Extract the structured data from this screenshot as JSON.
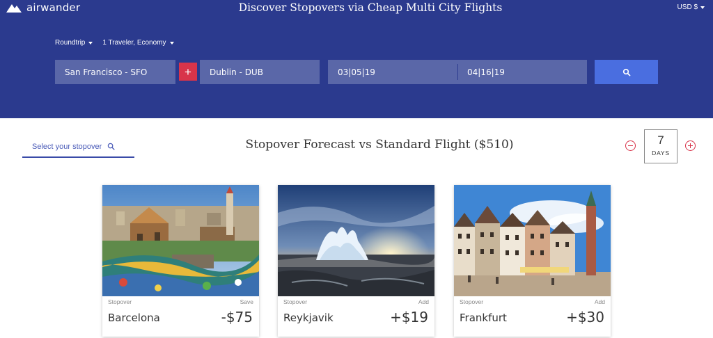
{
  "header": {
    "brand": "airwander",
    "title": "Discover Stopovers via Cheap Multi City Flights",
    "currency": "USD $"
  },
  "search": {
    "trip_type": "Roundtrip",
    "travelers": "1 Traveler, Economy",
    "origin": "San Francisco - SFO",
    "add_stop_label": "+",
    "destination": "Dublin - DUB",
    "depart_date": "03|05|19",
    "return_date": "04|16|19"
  },
  "stopover_select": {
    "placeholder": "Select your stopover"
  },
  "forecast": {
    "title": "Stopover Forecast vs Standard Flight ($510)"
  },
  "days": {
    "value": "7",
    "label": "DAYS"
  },
  "cards": [
    {
      "type_label": "Stopover",
      "action": "Save",
      "city": "Barcelona",
      "price": "-$75"
    },
    {
      "type_label": "Stopover",
      "action": "Add",
      "city": "Reykjavik",
      "price": "+$19"
    },
    {
      "type_label": "Stopover",
      "action": "Add",
      "city": "Frankfurt",
      "price": "+$30"
    }
  ],
  "colors": {
    "header_bg": "#2b3a8e",
    "field_bg": "#5a67a8",
    "accent_red": "#d8344a",
    "search_button": "#4a6ee0"
  },
  "icons": {
    "logo": "mountain-logo-icon",
    "search": "search-icon",
    "decrement": "minus-circle-icon",
    "increment": "plus-circle-icon"
  }
}
